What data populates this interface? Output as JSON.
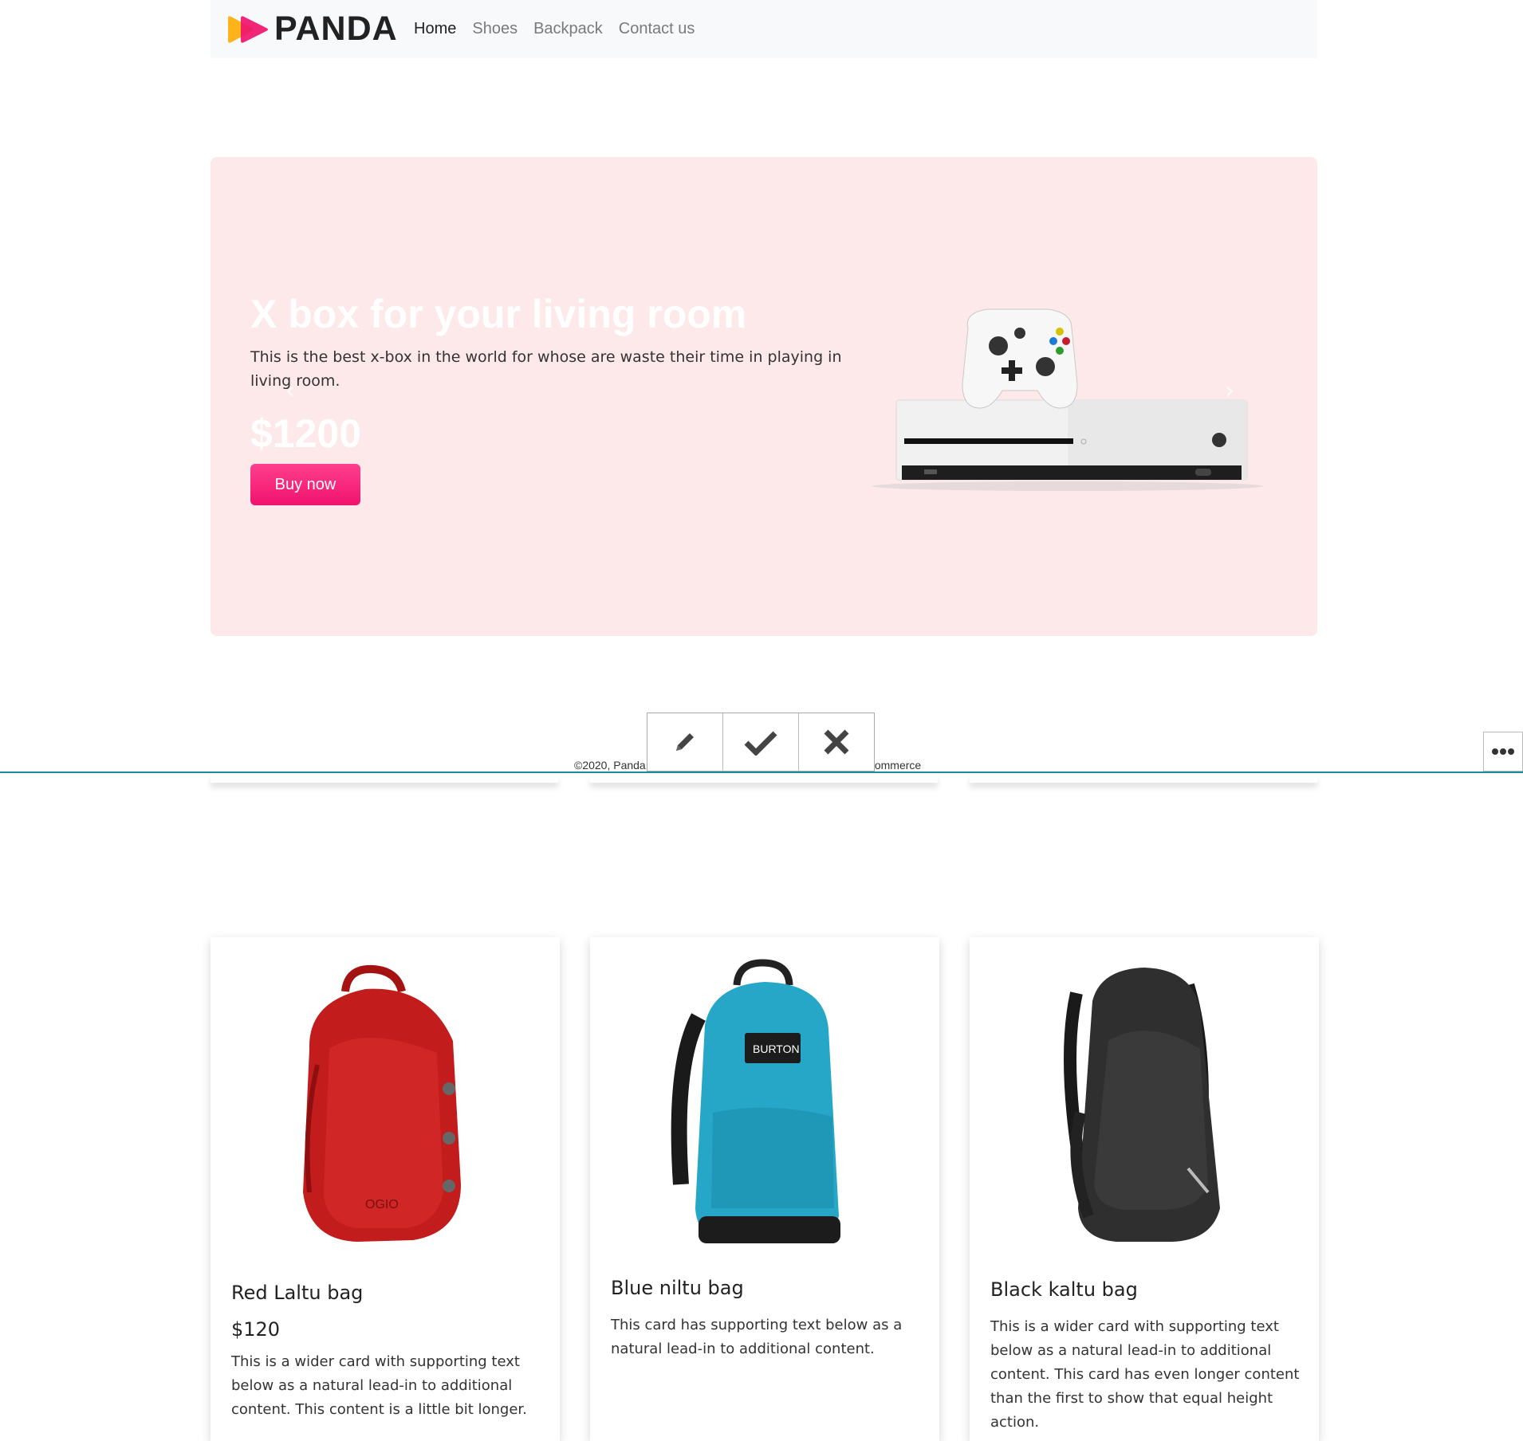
{
  "brand": {
    "name": "PANDA"
  },
  "nav": {
    "items": [
      {
        "label": "Home",
        "active": true
      },
      {
        "label": "Shoes",
        "active": false
      },
      {
        "label": "Backpack",
        "active": false
      },
      {
        "label": "Contact us",
        "active": false
      }
    ]
  },
  "hero": {
    "title": "X box for your living room",
    "description": "This is the best x-box in the world for whose are waste their time in playing in living room.",
    "price": "$1200",
    "button": "Buy now",
    "prev_icon": "chevron-left-icon",
    "next_icon": "chevron-right-icon",
    "background": "#fde9e9",
    "accent": "#f0136d"
  },
  "toolbar": {
    "icons": [
      "pencil-icon",
      "check-icon",
      "close-icon"
    ],
    "more_icon": "more-icon"
  },
  "footer": {
    "text": "©2020, Panda e-commerce. All rights reserved by Panda e-commerce"
  },
  "products": [
    {
      "title": "Red Laltu bag",
      "price": "$120",
      "text": "This is a wider card with supporting text below as a natural lead-in to additional content. This content is a little bit longer."
    },
    {
      "title": "Blue niltu bag",
      "text": "This card has supporting text below as a natural lead-in to additional content."
    },
    {
      "title": "Black kaltu bag",
      "text": "This is a wider card with supporting text below as a natural lead-in to additional content. This card has even longer content than the first to show that equal height action."
    }
  ]
}
